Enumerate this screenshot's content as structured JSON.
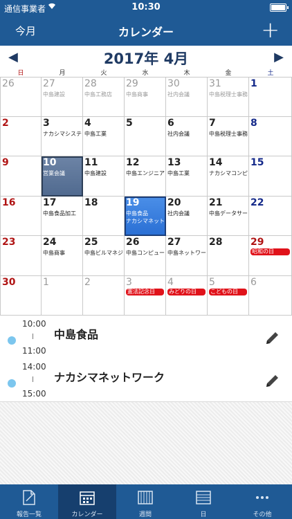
{
  "status": {
    "carrier": "通信事業者",
    "time": "10:30"
  },
  "navbar": {
    "left": "今月",
    "title": "カレンダー",
    "plus": "+"
  },
  "monthbar": {
    "prev": "◀",
    "month": "2017年 4月",
    "next": "▶"
  },
  "weekdays": [
    "日",
    "月",
    "火",
    "水",
    "木",
    "金",
    "土"
  ],
  "weeks": [
    [
      {
        "day": "26",
        "style": "grey",
        "events": []
      },
      {
        "day": "27",
        "style": "grey",
        "events": [
          "中島建設"
        ]
      },
      {
        "day": "28",
        "style": "grey",
        "events": [
          "中島工務店"
        ]
      },
      {
        "day": "29",
        "style": "grey",
        "events": [
          "中島商事"
        ]
      },
      {
        "day": "30",
        "style": "grey",
        "events": [
          "社内会議"
        ]
      },
      {
        "day": "31",
        "style": "grey",
        "events": [
          "中島税理士事務"
        ]
      },
      {
        "day": "1",
        "style": "blue",
        "events": []
      }
    ],
    [
      {
        "day": "2",
        "style": "red",
        "events": []
      },
      {
        "day": "3",
        "style": "",
        "events": [
          "ナカシマシステ"
        ]
      },
      {
        "day": "4",
        "style": "",
        "events": [
          "中島工業"
        ]
      },
      {
        "day": "5",
        "style": "",
        "events": []
      },
      {
        "day": "6",
        "style": "",
        "events": [
          "社内会議"
        ]
      },
      {
        "day": "7",
        "style": "",
        "events": [
          "中島税理士事務"
        ]
      },
      {
        "day": "8",
        "style": "blue",
        "events": []
      }
    ],
    [
      {
        "day": "9",
        "style": "red",
        "events": []
      },
      {
        "day": "10",
        "style": "",
        "events": [
          "営業会議"
        ],
        "selected": "grey"
      },
      {
        "day": "11",
        "style": "",
        "events": [
          "中島建設"
        ]
      },
      {
        "day": "12",
        "style": "",
        "events": [
          "中島エンジニア"
        ]
      },
      {
        "day": "13",
        "style": "",
        "events": [
          "中島工業"
        ]
      },
      {
        "day": "14",
        "style": "",
        "events": [
          "ナカシマコンピ"
        ]
      },
      {
        "day": "15",
        "style": "blue",
        "events": []
      }
    ],
    [
      {
        "day": "16",
        "style": "red",
        "events": []
      },
      {
        "day": "17",
        "style": "",
        "events": [
          "中島食品加工"
        ]
      },
      {
        "day": "18",
        "style": "",
        "events": []
      },
      {
        "day": "19",
        "style": "",
        "events": [
          "中島食品",
          "ナカシマネット"
        ],
        "selected": "blue"
      },
      {
        "day": "20",
        "style": "",
        "events": [
          "社内会議"
        ]
      },
      {
        "day": "21",
        "style": "",
        "events": [
          "中島データサー"
        ]
      },
      {
        "day": "22",
        "style": "blue",
        "events": []
      }
    ],
    [
      {
        "day": "23",
        "style": "red",
        "events": []
      },
      {
        "day": "24",
        "style": "",
        "events": [
          "中島商事"
        ]
      },
      {
        "day": "25",
        "style": "",
        "events": [
          "中島ビルマネジ"
        ]
      },
      {
        "day": "26",
        "style": "",
        "events": [
          "中島コンピュー"
        ]
      },
      {
        "day": "27",
        "style": "",
        "events": [
          "中島ネットワー"
        ]
      },
      {
        "day": "28",
        "style": "",
        "events": []
      },
      {
        "day": "29",
        "style": "red",
        "events": [],
        "holiday": "昭和の日"
      }
    ],
    [
      {
        "day": "30",
        "style": "red",
        "events": []
      },
      {
        "day": "1",
        "style": "grey",
        "events": []
      },
      {
        "day": "2",
        "style": "grey",
        "events": []
      },
      {
        "day": "3",
        "style": "grey",
        "events": [],
        "holiday": "憲法記念日"
      },
      {
        "day": "4",
        "style": "grey",
        "events": [],
        "holiday": "みどりの日"
      },
      {
        "day": "5",
        "style": "grey",
        "events": [],
        "holiday": "こどもの日"
      },
      {
        "day": "6",
        "style": "grey",
        "events": []
      }
    ]
  ],
  "events": [
    {
      "start": "10:00",
      "end": "11:00",
      "name": "中島食品"
    },
    {
      "start": "14:00",
      "end": "15:00",
      "name": "ナカシマネットワーク"
    }
  ],
  "tabs": [
    {
      "label": "報告一覧",
      "icon": "report-icon"
    },
    {
      "label": "カレンダー",
      "icon": "calendar-icon",
      "active": true
    },
    {
      "label": "週間",
      "icon": "week-icon"
    },
    {
      "label": "日",
      "icon": "day-icon"
    },
    {
      "label": "その他",
      "icon": "more-icon"
    }
  ]
}
